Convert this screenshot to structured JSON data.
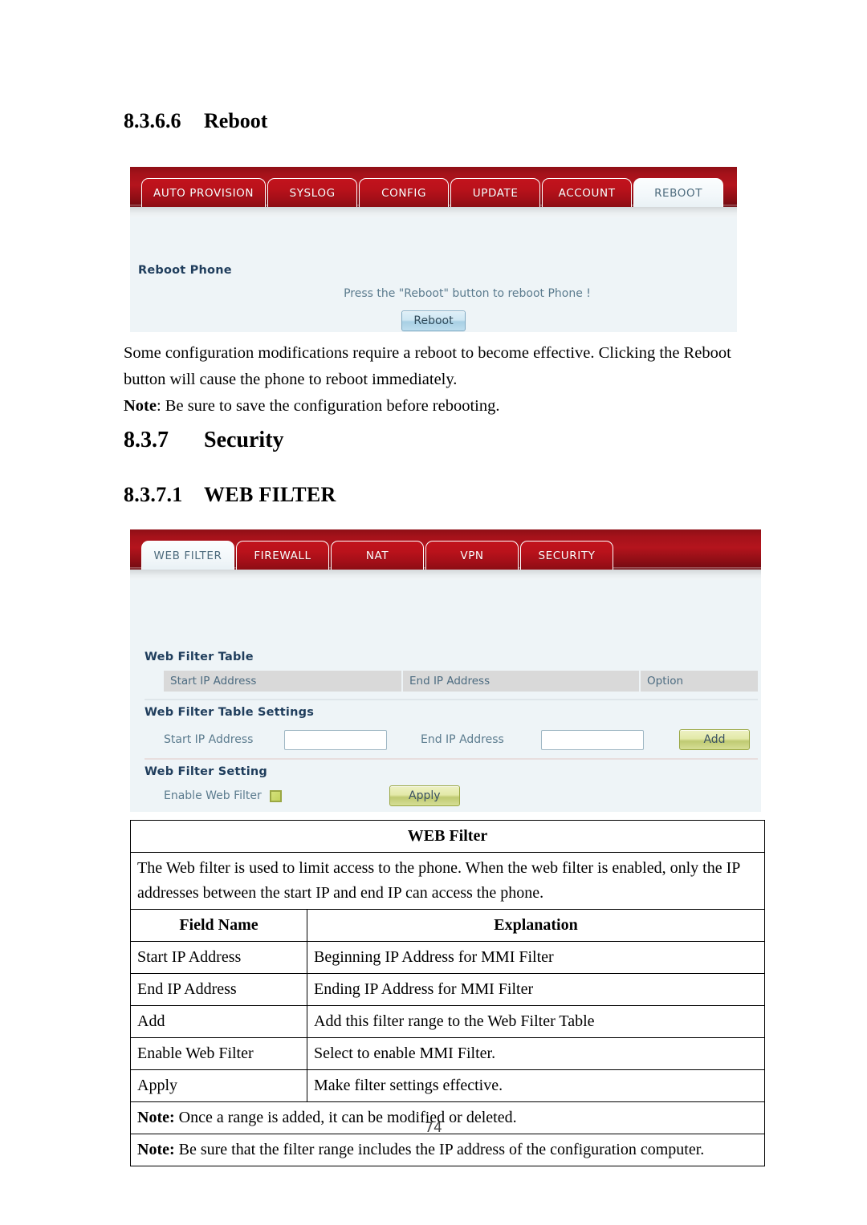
{
  "doc": {
    "page_number": "74"
  },
  "section_reboot": {
    "number": "8.3.6.6",
    "title": "Reboot",
    "panel": {
      "tabs": [
        {
          "label": "AUTO PROVISION",
          "active": false
        },
        {
          "label": "SYSLOG",
          "active": false
        },
        {
          "label": "CONFIG",
          "active": false
        },
        {
          "label": "UPDATE",
          "active": false
        },
        {
          "label": "ACCOUNT",
          "active": false
        },
        {
          "label": "REBOOT",
          "active": true
        }
      ],
      "group_title": "Reboot Phone",
      "hint": "Press the \"Reboot\" button to reboot Phone !",
      "reboot_button": "Reboot"
    },
    "paragraph_line1": "Some configuration modifications require a reboot to become effective.    Clicking the Reboot",
    "paragraph_line2": "button will cause the phone to reboot immediately.",
    "note_label": "Note",
    "note_text": ": Be sure to save the configuration before rebooting."
  },
  "section_security": {
    "number": "8.3.7",
    "title": "Security"
  },
  "section_web_filter": {
    "number": "8.3.7.1",
    "title": "WEB FILTER",
    "panel": {
      "tabs": [
        {
          "label": "WEB FILTER",
          "active": true
        },
        {
          "label": "FIREWALL",
          "active": false
        },
        {
          "label": "NAT",
          "active": false
        },
        {
          "label": "VPN",
          "active": false
        },
        {
          "label": "SECURITY",
          "active": false
        }
      ],
      "table_group_title": "Web Filter Table",
      "table_columns": [
        "Start IP Address",
        "End IP Address",
        "Option"
      ],
      "settings_group_title": "Web Filter Table Settings",
      "settings_start_label": "Start IP Address",
      "settings_start_value": "",
      "settings_end_label": "End IP Address",
      "settings_end_value": "",
      "add_button": "Add",
      "setting_group_title": "Web Filter Setting",
      "enable_label": "Enable Web Filter",
      "apply_button": "Apply"
    },
    "doc_table": {
      "title": "WEB Filter",
      "description_line1": "The Web filter is used to limit access to the phone.    When the web filter is enabled, only the",
      "description_line2": "IP addresses between the start IP and end IP can access the phone.",
      "col_field": "Field Name",
      "col_explanation": "Explanation",
      "rows": [
        {
          "field": "Start IP Address",
          "explanation": "Beginning IP Address for MMI Filter"
        },
        {
          "field": "End IP Address",
          "explanation": "Ending IP Address for MMI Filter"
        },
        {
          "field": "Add",
          "explanation": "Add this filter range to the Web Filter Table"
        },
        {
          "field": "Enable Web Filter",
          "explanation": "Select to enable MMI Filter."
        },
        {
          "field": "Apply",
          "explanation": "Make filter settings effective."
        }
      ],
      "note1_label": "Note:",
      "note1_text": " Once a range is added, it can be modified or deleted.",
      "note2_label": "Note:",
      "note2_text": " Be sure that the filter range includes the IP address of the configuration computer."
    }
  },
  "colors": {
    "tab_red": "#b4141d",
    "panel_bg": "#eef4f7",
    "accent_green": "#c3d35e",
    "button_blue": "#cfe7f3"
  }
}
